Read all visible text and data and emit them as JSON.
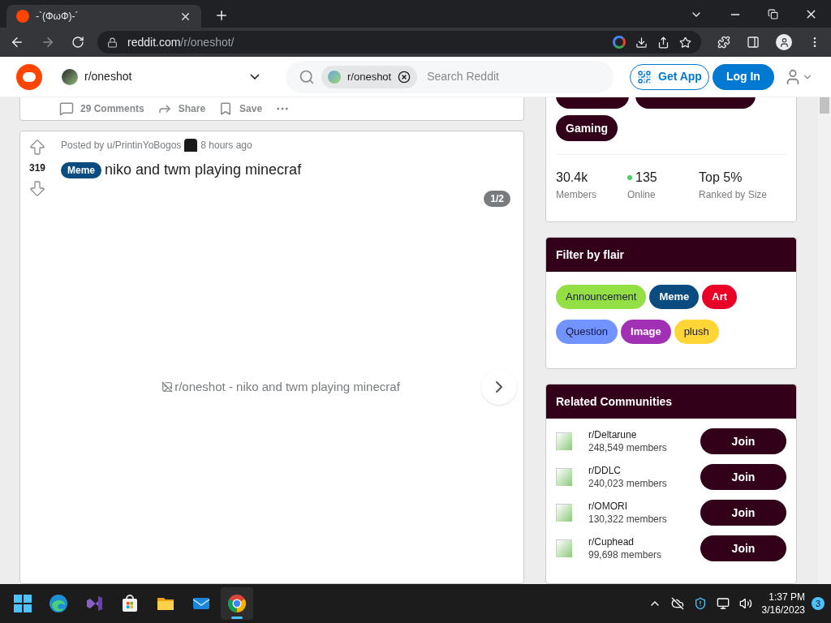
{
  "browser": {
    "tab_title": "-`(ΦωΦ)-´",
    "url_host": "reddit.com",
    "url_path": "/r/oneshot/"
  },
  "header": {
    "community": "r/oneshot",
    "search_chip": "r/oneshot",
    "search_placeholder": "Search Reddit",
    "get_app": "Get App",
    "login": "Log In"
  },
  "previous_post": {
    "actions": [
      "29 Comments",
      "Share",
      "Save"
    ]
  },
  "post": {
    "posted_by": "Posted by u/PrintinYoBogos",
    "time": "8 hours ago",
    "votes": "319",
    "flair": {
      "label": "Meme",
      "color": "#0a4b80"
    },
    "title": "niko and twm playing minecraf",
    "gallery_counter": "1/2",
    "image_alt": "r/oneshot - niko and twm playing minecraf"
  },
  "community": {
    "topics": [
      "Gaming"
    ],
    "stats": [
      {
        "value": "30.4k",
        "label": "Members",
        "kind": "count"
      },
      {
        "value": "135",
        "label": "Online",
        "kind": "online"
      },
      {
        "value": "Top 5%",
        "label": "Ranked by Size",
        "kind": "count"
      }
    ]
  },
  "filter": {
    "title": "Filter by flair",
    "flairs": [
      {
        "label": "Announcement",
        "color": "#94e044",
        "dark_text": true
      },
      {
        "label": "Meme",
        "color": "#0a4b80",
        "dark_text": false
      },
      {
        "label": "Art",
        "color": "#ea0027",
        "dark_text": false
      },
      {
        "label": "Question",
        "color": "#7193ff",
        "dark_text": true
      },
      {
        "label": "Image",
        "color": "#a230b5",
        "dark_text": false
      },
      {
        "label": "plush",
        "color": "#ffd635",
        "dark_text": true
      }
    ]
  },
  "related": {
    "title": "Related Communities",
    "items": [
      {
        "name": "r/Deltarune",
        "members": "248,549 members",
        "button": "Join"
      },
      {
        "name": "r/DDLC",
        "members": "240,023 members",
        "button": "Join"
      },
      {
        "name": "r/OMORI",
        "members": "130,322 members",
        "button": "Join"
      },
      {
        "name": "r/Cuphead",
        "members": "99,698 members",
        "button": "Join"
      }
    ]
  },
  "taskbar": {
    "apps": [
      {
        "kind": "edge",
        "selected": false
      },
      {
        "kind": "vs",
        "selected": false
      },
      {
        "kind": "store",
        "selected": false
      },
      {
        "kind": "folder",
        "selected": false
      },
      {
        "kind": "mail",
        "selected": false
      },
      {
        "kind": "chrome",
        "selected": true
      }
    ],
    "time": "1:37 PM",
    "date": "3/16/2023",
    "notifications": "3"
  }
}
